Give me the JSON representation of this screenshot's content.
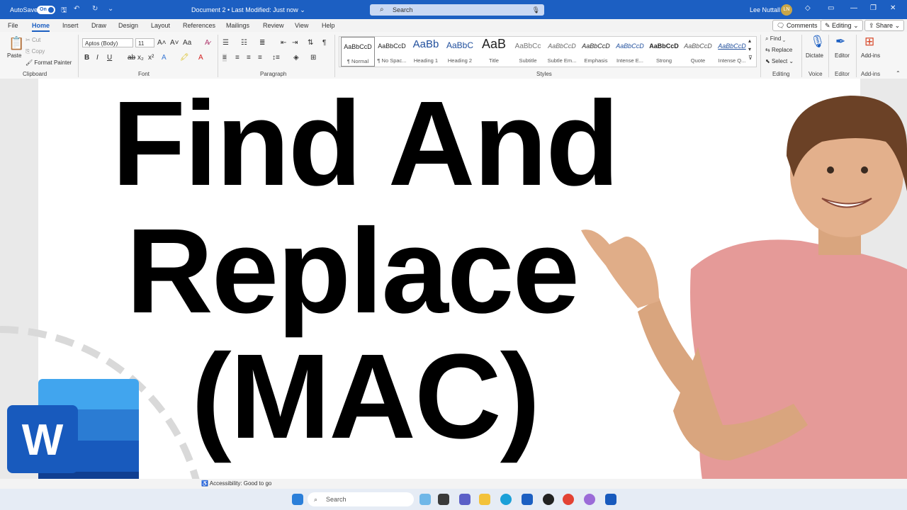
{
  "titlebar": {
    "autosave_label": "AutoSave",
    "autosave_state": "On",
    "document_title": "Document 2 • Last Modified: Just now ⌄",
    "search_placeholder": "Search",
    "user_name": "Lee Nuttall",
    "user_initials": "LN"
  },
  "menu": {
    "tabs": [
      "File",
      "Home",
      "Insert",
      "Draw",
      "Design",
      "Layout",
      "References",
      "Mailings",
      "Review",
      "View",
      "Help"
    ],
    "active": "Home",
    "comments_label": "Comments",
    "editing_label": "Editing",
    "share_label": "Share"
  },
  "ribbon": {
    "clipboard": {
      "paste": "Paste",
      "cut": "Cut",
      "copy": "Copy",
      "format_painter": "Format Painter",
      "label": "Clipboard"
    },
    "font": {
      "family": "Aptos (Body)",
      "size": "11",
      "label": "Font"
    },
    "paragraph": {
      "label": "Paragraph"
    },
    "styles": {
      "label": "Styles",
      "items": [
        {
          "preview": "AaBbCcD",
          "name": "¶ Normal"
        },
        {
          "preview": "AaBbCcD",
          "name": "¶ No Spac..."
        },
        {
          "preview": "AaBb",
          "name": "Heading 1"
        },
        {
          "preview": "AaBbC",
          "name": "Heading 2"
        },
        {
          "preview": "AaB",
          "name": "Title"
        },
        {
          "preview": "AaBbCc",
          "name": "Subtitle"
        },
        {
          "preview": "AaBbCcD",
          "name": "Subtle Em..."
        },
        {
          "preview": "AaBbCcD",
          "name": "Emphasis"
        },
        {
          "preview": "AaBbCcD",
          "name": "Intense E..."
        },
        {
          "preview": "AaBbCcD",
          "name": "Strong"
        },
        {
          "preview": "AaBbCcD",
          "name": "Quote"
        },
        {
          "preview": "AaBbCcD",
          "name": "Intense Q..."
        }
      ]
    },
    "editing": {
      "find": "Find",
      "replace": "Replace",
      "select": "Select",
      "label": "Editing"
    },
    "voice": {
      "dictate": "Dictate",
      "label": "Voice"
    },
    "editor": {
      "editor": "Editor",
      "label": "Editor"
    },
    "addins": {
      "addins": "Add-ins",
      "label": "Add-ins"
    }
  },
  "document": {
    "line1": "Find And",
    "line2": "Replace",
    "line3": "(MAC)"
  },
  "statusbar": {
    "accessibility": "Accessibility: Good to go"
  },
  "taskbar": {
    "search": "Search"
  },
  "colors": {
    "word_blue": "#1c5fc2",
    "shirt": "#e59a98"
  },
  "logo": {
    "letter": "W"
  }
}
